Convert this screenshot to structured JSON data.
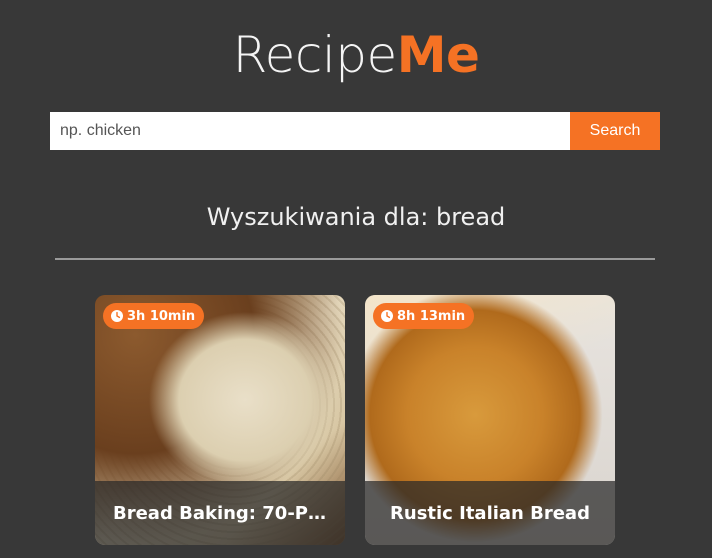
{
  "logo": {
    "part1": "Recipe",
    "part2": "Me"
  },
  "search": {
    "placeholder": "np. chicken",
    "value": "",
    "button_label": "Search"
  },
  "results": {
    "heading": "Wyszukiwania dla: bread"
  },
  "recipes": [
    {
      "time": "3h 10min",
      "title": "Bread Baking: 70-Per..."
    },
    {
      "time": "8h 13min",
      "title": "Rustic Italian Bread"
    }
  ],
  "colors": {
    "background": "#383838",
    "accent": "#f57224"
  },
  "icons": {
    "time": "clock-icon"
  }
}
